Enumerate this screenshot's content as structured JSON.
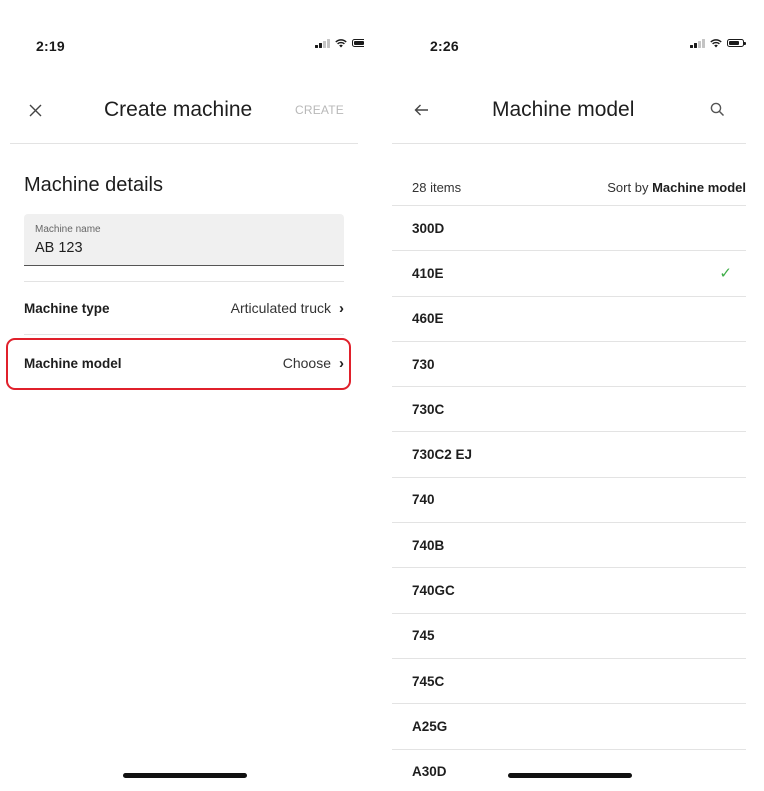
{
  "left": {
    "status_time": "2:19",
    "title": "Create machine",
    "create_label": "CREATE",
    "section_title": "Machine details",
    "machine_name": {
      "label": "Machine name",
      "value": "AB 123"
    },
    "machine_type": {
      "label": "Machine type",
      "value": "Articulated truck"
    },
    "machine_model": {
      "label": "Machine model",
      "value": "Choose"
    },
    "highlight_color": "#e0202b"
  },
  "right": {
    "status_time": "2:26",
    "title": "Machine model",
    "items_count": "28 items",
    "sort_prefix": "Sort by",
    "sort_value": "Machine model",
    "models": [
      {
        "name": "300D",
        "selected": false
      },
      {
        "name": "410E",
        "selected": true
      },
      {
        "name": "460E",
        "selected": false
      },
      {
        "name": "730",
        "selected": false
      },
      {
        "name": "730C",
        "selected": false
      },
      {
        "name": "730C2 EJ",
        "selected": false
      },
      {
        "name": "740",
        "selected": false
      },
      {
        "name": "740B",
        "selected": false
      },
      {
        "name": "740GC",
        "selected": false
      },
      {
        "name": "745",
        "selected": false
      },
      {
        "name": "745C",
        "selected": false
      },
      {
        "name": "A25G",
        "selected": false
      },
      {
        "name": "A30D",
        "selected": false
      }
    ],
    "check_color": "#3fae49"
  },
  "icons": {
    "close": "close-icon",
    "back": "arrow-left-icon",
    "search": "search-icon",
    "chevron": "chevron-right-icon",
    "check": "checkmark-icon"
  }
}
